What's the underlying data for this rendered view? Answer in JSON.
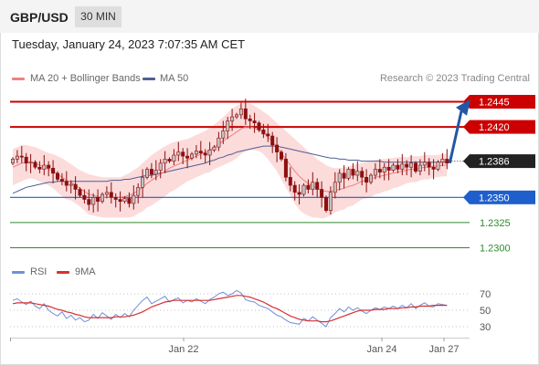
{
  "header": {
    "symbol": "GBP/USD",
    "timeframe": "30 MIN"
  },
  "datetime": "Tuesday, January 24, 2023 7:07:35 AM CET",
  "legend": {
    "ma20": "MA 20 + Bollinger Bands",
    "ma50": "MA 50",
    "credit": "Research © 2023 Trading Central",
    "rsi": "RSI",
    "rsi_ma": "9MA"
  },
  "colors": {
    "resistance": "#cc0000",
    "support": "#1f5fcc",
    "target": "#2e8b2e",
    "bull_candle": "#c2c2c2",
    "bear_candle": "#8c1010",
    "bollinger_fill": "#fbd5d5",
    "ma20": "#f08080",
    "ma50": "#4f5f95",
    "rsi": "#6f8fd8",
    "rsi_ma": "#d83030",
    "arrow": "#2357a6",
    "last_price_bg": "#222222"
  },
  "chart_data": {
    "type": "candlestick",
    "instrument": "GBP/USD",
    "interval": "30 MIN",
    "ylim": [
      1.2282,
      1.2466
    ],
    "x_tick_labels": [
      "Jan 22",
      "Jan 24",
      "Jan 27"
    ],
    "last_price": 1.2386,
    "price_levels": [
      {
        "label": "1.2445",
        "value": 1.2445,
        "kind": "resistance"
      },
      {
        "label": "1.2420",
        "value": 1.242,
        "kind": "resistance"
      },
      {
        "label": "1.2350",
        "value": 1.235,
        "kind": "support"
      },
      {
        "label": "1.2325",
        "value": 1.2325,
        "kind": "target"
      },
      {
        "label": "1.2300",
        "value": 1.23,
        "kind": "target"
      }
    ],
    "last_price_label": "1.2386",
    "projection": {
      "from": 1.2384,
      "to": 1.2442
    },
    "close": [
      1.2388,
      1.2391,
      1.239,
      1.2384,
      1.2385,
      1.238,
      1.2378,
      1.2382,
      1.2379,
      1.2374,
      1.2368,
      1.2366,
      1.2362,
      1.2363,
      1.2358,
      1.2352,
      1.2348,
      1.2343,
      1.235,
      1.2346,
      1.2353,
      1.2355,
      1.235,
      1.2348,
      1.2346,
      1.2349,
      1.2344,
      1.2352,
      1.236,
      1.237,
      1.2378,
      1.2373,
      1.2377,
      1.2384,
      1.2388,
      1.2386,
      1.2392,
      1.2395,
      1.2391,
      1.2389,
      1.2393,
      1.2396,
      1.2394,
      1.2392,
      1.2397,
      1.24,
      1.2409,
      1.2416,
      1.2426,
      1.243,
      1.2432,
      1.2438,
      1.2428,
      1.2426,
      1.2424,
      1.2417,
      1.2413,
      1.2411,
      1.2402,
      1.2395,
      1.2388,
      1.237,
      1.2362,
      1.2355,
      1.2353,
      1.2362,
      1.2358,
      1.2365,
      1.2358,
      1.235,
      1.2337,
      1.2355,
      1.2365,
      1.2374,
      1.2369,
      1.2378,
      1.2372,
      1.2376,
      1.237,
      1.2365,
      1.2372,
      1.2378,
      1.2375,
      1.238,
      1.2377,
      1.2382,
      1.2378,
      1.2383,
      1.238,
      1.2384,
      1.2376,
      1.2382,
      1.2385,
      1.238,
      1.2378,
      1.2385,
      1.2388,
      1.2384
    ],
    "ma20": [
      1.238,
      1.2382,
      1.2384,
      1.2385,
      1.2385,
      1.2384,
      1.2382,
      1.238,
      1.2378,
      1.2376,
      1.2373,
      1.237,
      1.2367,
      1.2365,
      1.2362,
      1.2359,
      1.2356,
      1.2353,
      1.2352,
      1.2351,
      1.235,
      1.235,
      1.235,
      1.235,
      1.235,
      1.2351,
      1.2352,
      1.2354,
      1.2357,
      1.236,
      1.2364,
      1.2367,
      1.237,
      1.2373,
      1.2376,
      1.2379,
      1.2381,
      1.2383,
      1.2385,
      1.2387,
      1.2389,
      1.2391,
      1.2393,
      1.2395,
      1.2397,
      1.24,
      1.2403,
      1.2406,
      1.2409,
      1.2412,
      1.2415,
      1.2418,
      1.242,
      1.242,
      1.2419,
      1.2417,
      1.2414,
      1.241,
      1.2405,
      1.24,
      1.2394,
      1.2388,
      1.2382,
      1.2376,
      1.2371,
      1.2367,
      1.2364,
      1.2361,
      1.2359,
      1.2357,
      1.2356,
      1.2356,
      1.2357,
      1.2358,
      1.2359,
      1.2361,
      1.2362,
      1.2364,
      1.2366,
      1.2367,
      1.2368,
      1.237,
      1.2371,
      1.2372,
      1.2373,
      1.2374,
      1.2375,
      1.2376,
      1.2377,
      1.2378,
      1.2378,
      1.2379,
      1.238,
      1.238,
      1.2381,
      1.2381,
      1.2382,
      1.2382
    ],
    "ma50": [
      1.2354,
      1.2356,
      1.2358,
      1.236,
      1.2361,
      1.2362,
      1.2363,
      1.2364,
      1.2365,
      1.2365,
      1.2366,
      1.2366,
      1.2366,
      1.2366,
      1.2366,
      1.2366,
      1.2366,
      1.2366,
      1.2366,
      1.2366,
      1.2366,
      1.2366,
      1.2367,
      1.2367,
      1.2367,
      1.2368,
      1.2368,
      1.2369,
      1.237,
      1.2371,
      1.2372,
      1.2372,
      1.2373,
      1.2374,
      1.2375,
      1.2376,
      1.2377,
      1.2378,
      1.2379,
      1.238,
      1.2381,
      1.2382,
      1.2383,
      1.2384,
      1.2386,
      1.2387,
      1.2389,
      1.239,
      1.2392,
      1.2393,
      1.2395,
      1.2396,
      1.2397,
      1.2398,
      1.2399,
      1.24,
      1.2401,
      1.2401,
      1.2401,
      1.2401,
      1.24,
      1.2399,
      1.2398,
      1.2397,
      1.2396,
      1.2395,
      1.2394,
      1.2393,
      1.2392,
      1.2391,
      1.239,
      1.2389,
      1.2389,
      1.2388,
      1.2388,
      1.2387,
      1.2387,
      1.2387,
      1.2386,
      1.2386,
      1.2386,
      1.2386,
      1.2386,
      1.2385,
      1.2385,
      1.2385,
      1.2385,
      1.2385,
      1.2385,
      1.2385,
      1.2385,
      1.2385,
      1.2385,
      1.2385,
      1.2385,
      1.2385,
      1.2385,
      1.2385
    ],
    "bollinger_upper": [
      1.2398,
      1.24,
      1.2402,
      1.2402,
      1.2401,
      1.24,
      1.2398,
      1.2396,
      1.2394,
      1.2393,
      1.2391,
      1.2389,
      1.2386,
      1.2383,
      1.238,
      1.2377,
      1.2375,
      1.2373,
      1.2372,
      1.2371,
      1.237,
      1.237,
      1.237,
      1.237,
      1.237,
      1.2372,
      1.2374,
      1.2377,
      1.238,
      1.2384,
      1.2388,
      1.2392,
      1.2395,
      1.2398,
      1.2401,
      1.2403,
      1.2405,
      1.2406,
      1.2407,
      1.2408,
      1.241,
      1.2412,
      1.2414,
      1.2416,
      1.2419,
      1.2422,
      1.2426,
      1.243,
      1.2434,
      1.2438,
      1.2441,
      1.2443,
      1.2444,
      1.2443,
      1.2441,
      1.2438,
      1.2435,
      1.2432,
      1.2428,
      1.2424,
      1.242,
      1.2416,
      1.2412,
      1.2408,
      1.2404,
      1.24,
      1.2396,
      1.2392,
      1.2388,
      1.2385,
      1.2382,
      1.238,
      1.2379,
      1.2379,
      1.238,
      1.2381,
      1.2382,
      1.2383,
      1.2384,
      1.2385,
      1.2386,
      1.2387,
      1.2388,
      1.2388,
      1.2389,
      1.2389,
      1.239,
      1.239,
      1.239,
      1.2391,
      1.2391,
      1.2391,
      1.2392,
      1.2392,
      1.2392,
      1.2392,
      1.2393,
      1.2393
    ],
    "bollinger_lower": [
      1.2362,
      1.2364,
      1.2366,
      1.2368,
      1.2369,
      1.2368,
      1.2366,
      1.2364,
      1.2362,
      1.2359,
      1.2355,
      1.2351,
      1.2348,
      1.2347,
      1.2344,
      1.2341,
      1.2337,
      1.2333,
      1.2332,
      1.2331,
      1.233,
      1.233,
      1.233,
      1.233,
      1.233,
      1.233,
      1.233,
      1.2331,
      1.2334,
      1.2336,
      1.234,
      1.2342,
      1.2345,
      1.2348,
      1.2351,
      1.2355,
      1.2357,
      1.236,
      1.2363,
      1.2366,
      1.2368,
      1.237,
      1.2372,
      1.2374,
      1.2375,
      1.2378,
      1.238,
      1.2382,
      1.2384,
      1.2386,
      1.2389,
      1.2393,
      1.2396,
      1.2397,
      1.2397,
      1.2396,
      1.2393,
      1.2388,
      1.2382,
      1.2376,
      1.2368,
      1.236,
      1.2352,
      1.2344,
      1.2338,
      1.2334,
      1.2332,
      1.233,
      1.233,
      1.2329,
      1.233,
      1.2332,
      1.2335,
      1.2337,
      1.2338,
      1.2341,
      1.2342,
      1.2345,
      1.2348,
      1.2349,
      1.235,
      1.2353,
      1.2354,
      1.2356,
      1.2357,
      1.2359,
      1.236,
      1.2362,
      1.2364,
      1.2365,
      1.2365,
      1.2367,
      1.2368,
      1.2368,
      1.237,
      1.237,
      1.2371,
      1.2371
    ]
  },
  "rsi_panel": {
    "ylim": [
      20,
      80
    ],
    "levels": [
      {
        "label": "70",
        "value": 70
      },
      {
        "label": "50",
        "value": 50
      },
      {
        "label": "30",
        "value": 30
      }
    ],
    "rsi": [
      62,
      64,
      60,
      57,
      61,
      55,
      52,
      58,
      50,
      46,
      43,
      48,
      40,
      44,
      38,
      41,
      36,
      38,
      45,
      40,
      47,
      43,
      39,
      45,
      41,
      46,
      42,
      50,
      56,
      62,
      66,
      58,
      61,
      64,
      67,
      60,
      63,
      65,
      59,
      62,
      60,
      64,
      61,
      58,
      63,
      66,
      70,
      72,
      68,
      70,
      74,
      71,
      63,
      61,
      60,
      56,
      54,
      52,
      48,
      44,
      42,
      38,
      35,
      34,
      33,
      40,
      37,
      42,
      38,
      34,
      30,
      41,
      46,
      52,
      48,
      54,
      50,
      53,
      49,
      46,
      50,
      53,
      51,
      54,
      52,
      55,
      52,
      56,
      53,
      58,
      52,
      56,
      59,
      55,
      54,
      58,
      57,
      56
    ],
    "rsi_ma": [
      58,
      59,
      59,
      59,
      59,
      58,
      57,
      56,
      55,
      53,
      51,
      50,
      48,
      47,
      45,
      44,
      42,
      41,
      41,
      41,
      41,
      41,
      41,
      42,
      42,
      42,
      43,
      44,
      46,
      48,
      51,
      54,
      56,
      58,
      60,
      61,
      62,
      62,
      62,
      62,
      62,
      62,
      62,
      62,
      62,
      63,
      64,
      65,
      66,
      67,
      68,
      68,
      67,
      66,
      64,
      62,
      60,
      57,
      54,
      52,
      49,
      46,
      43,
      41,
      39,
      38,
      37,
      37,
      37,
      36,
      36,
      37,
      39,
      41,
      43,
      45,
      47,
      49,
      50,
      50,
      50,
      51,
      51,
      51,
      52,
      52,
      52,
      53,
      53,
      54,
      54,
      55,
      55,
      55,
      56,
      56,
      56,
      56
    ]
  }
}
